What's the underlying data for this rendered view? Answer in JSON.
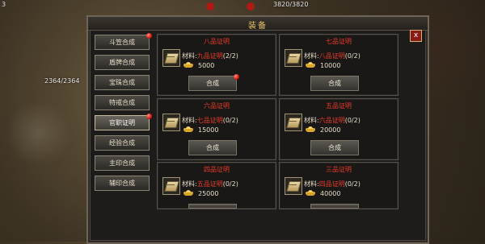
{
  "scene": {
    "corner_number": "3",
    "left_hp": "2364/2364",
    "top_hp": "3820/3820"
  },
  "panel": {
    "title": "装备",
    "close_label": "x"
  },
  "sidebar": {
    "items": [
      {
        "label": "斗笠合成",
        "badge": true,
        "active": false
      },
      {
        "label": "盾牌合成",
        "badge": false,
        "active": false
      },
      {
        "label": "宝珠合成",
        "badge": false,
        "active": false
      },
      {
        "label": "特戒合成",
        "badge": false,
        "active": false
      },
      {
        "label": "官职证明",
        "badge": true,
        "active": true
      },
      {
        "label": "经验合成",
        "badge": false,
        "active": false
      },
      {
        "label": "主印合成",
        "badge": false,
        "active": false
      },
      {
        "label": "辅印合成",
        "badge": false,
        "active": false
      }
    ]
  },
  "cards": [
    {
      "title": "八品证明",
      "material_prefix": "材料:",
      "material_name": "九品证明",
      "material_count": "(2/2)",
      "gold": "5000",
      "button": "合成",
      "badge": true
    },
    {
      "title": "七品证明",
      "material_prefix": "材料:",
      "material_name": "八品证明",
      "material_count": "(0/2)",
      "gold": "10000",
      "button": "合成",
      "badge": false
    },
    {
      "title": "六品证明",
      "material_prefix": "材料:",
      "material_name": "七品证明",
      "material_count": "(0/2)",
      "gold": "15000",
      "button": "合成",
      "badge": false
    },
    {
      "title": "五品证明",
      "material_prefix": "材料:",
      "material_name": "六品证明",
      "material_count": "(0/2)",
      "gold": "20000",
      "button": "合成",
      "badge": false
    },
    {
      "title": "四品证明",
      "material_prefix": "材料:",
      "material_name": "五品证明",
      "material_count": "(0/2)",
      "gold": "25000",
      "button": "",
      "badge": false
    },
    {
      "title": "三品证明",
      "material_prefix": "材料:",
      "material_name": "四品证明",
      "material_count": "(0/2)",
      "gold": "40000",
      "button": "",
      "badge": false
    }
  ],
  "colors": {
    "title": "#e8c46a",
    "card_title": "#e73a2a",
    "text": "#e6ddc8",
    "badge": "#d01810"
  },
  "icons": {
    "material": "book-icon",
    "currency": "gold-ingot-icon",
    "badge": "red-dot-icon"
  }
}
